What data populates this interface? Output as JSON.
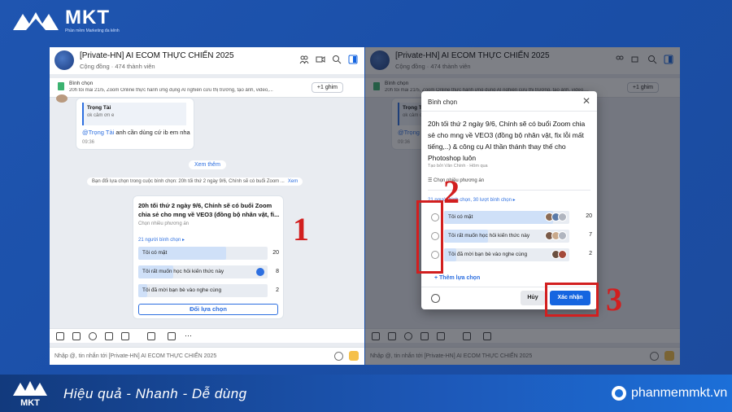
{
  "brand": {
    "name": "MKT",
    "subtitle": "Phần mềm Marketing đa kênh",
    "tagline": "Hiệu quả - Nhanh  - Dễ dùng",
    "website": "phanmemmkt.vn"
  },
  "chat": {
    "title": "[Private-HN] AI ECOM THỰC CHIẾN 2025",
    "community_label": "Cộng đồng",
    "members": "474 thành viên",
    "pinned_label": "Bình chọn",
    "pinned_text": "20h tối mai 21/5, Zoom Online thực hành ứng dụng AI nghiên cứu thị trường, tạo ảnh, video,...",
    "pin_count": "+1 ghim",
    "quote_name": "Trọng Tài",
    "quote_text": "ok cảm ơn e",
    "reply_mention": "@Trọng Tài",
    "reply_text": " anh cần dùng cứ ib em nha",
    "reply_time": "09:36",
    "see_more": "Xem thêm",
    "system_notice": "Bạn đổi lựa chọn trong cuộc bình chọn: 20h tối thứ 2 ngày 9/6, Chính sẽ có buổi Zoom ...",
    "system_notice_link": "Xem",
    "input_placeholder": "Nhập @, tin nhắn tới [Private-HN] AI ECOM THỰC CHIẾN 2025"
  },
  "poll": {
    "question": "20h tối thứ 2 ngày 9/6, Chính sẽ có buổi Zoom chia sẻ cho mng về VEO3 (đồng bộ nhân vật, fi...",
    "hint": "Chọn nhiều phương án",
    "voters": "21 người bình chọn",
    "options": [
      {
        "label": "Tôi có mặt",
        "count": "20",
        "fill": 0.68
      },
      {
        "label": "Tôi rất muốn học hỏi kiến thức này",
        "count": "8",
        "fill": 0.27
      },
      {
        "label": "Tôi đã mời bạn bè vào nghe cùng",
        "count": "2",
        "fill": 0.07
      }
    ],
    "change_button": "Đổi lựa chọn"
  },
  "modal": {
    "header": "Bình chọn",
    "question": "20h tối thứ 2 ngày 9/6, Chính sẽ có buổi Zoom chia sẻ cho mng về VEO3 (đồng bộ nhân vật, fix lỗi mất tiếng,..) & công cụ AI thần thánh thay thế cho Photoshop luôn",
    "creator": "Tạo bởi Văn Chính · Hôm qua",
    "multi": "Chọn nhiều phương án",
    "voters": "21 người bình chọn, 30 lượt bình chọn",
    "options": [
      {
        "label": "Tôi có mặt",
        "count": "20",
        "fill": 0.87
      },
      {
        "label": "Tôi rất muốn học hỏi kiến thức này",
        "count": "7",
        "fill": 0.35
      },
      {
        "label": "Tôi đã mời bạn bè vào nghe cùng",
        "count": "2",
        "fill": 0.1
      }
    ],
    "add_option": "+ Thêm lựa chọn",
    "cancel": "Hủy",
    "confirm": "Xác nhận"
  },
  "annotations": {
    "one": "1",
    "two": "2",
    "three": "3"
  }
}
